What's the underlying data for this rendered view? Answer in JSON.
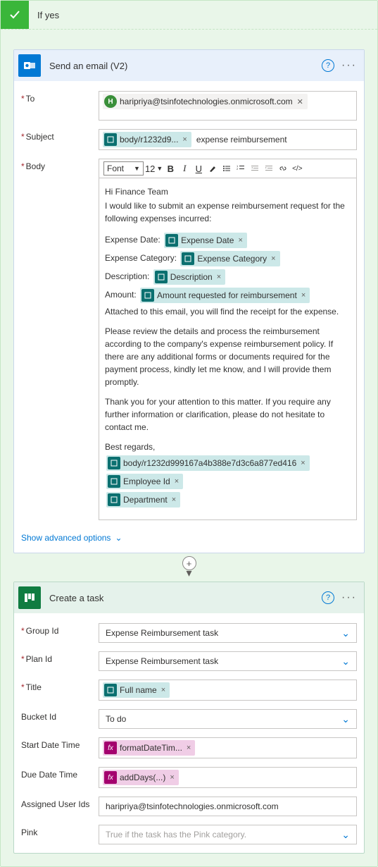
{
  "condition": {
    "title": "If yes"
  },
  "email_action": {
    "title": "Send an email (V2)",
    "fields": {
      "to_label": "To",
      "subject_label": "Subject",
      "body_label": "Body"
    },
    "to_pill": "haripriya@tsinfotechnologies.onmicrosoft.com",
    "subject_token": "body/r1232d9...",
    "subject_text": "expense reimbursement",
    "toolbar": {
      "font": "Font",
      "size": "12"
    },
    "body": {
      "greeting": "Hi Finance Team",
      "intro": "I would like to submit an expense reimbursement request for the following expenses incurred:",
      "line_date_label": "Expense Date:",
      "token_date": "Expense Date",
      "line_cat_label": "Expense Category:",
      "token_cat": "Expense Category",
      "line_desc_label": "Description:",
      "token_desc": "Description",
      "line_amount_label": "Amount:",
      "token_amount": "Amount requested for reimbursement",
      "attach": "Attached to this email, you will find the receipt for the expense.",
      "review": "Please review the details and process the reimbursement according to the company's expense reimbursement policy. If there are any additional forms or documents required for the payment process, kindly let me know, and I will provide them promptly.",
      "thanks": "Thank you for your attention to this matter. If you require any further information or clarification, please do not hesitate to contact me.",
      "regards": "Best regards,",
      "token_body_hash": "body/r1232d999167a4b388e7d3c6a877ed416",
      "token_emp": "Employee Id",
      "token_dept": "Department"
    },
    "advanced": "Show advanced options"
  },
  "task_action": {
    "title": "Create a task",
    "fields": {
      "group_label": "Group Id",
      "group_value": "Expense Reimbursement task",
      "plan_label": "Plan Id",
      "plan_value": "Expense Reimbursement task",
      "title_label": "Title",
      "title_token": "Full name",
      "bucket_label": "Bucket Id",
      "bucket_value": "To do",
      "start_label": "Start Date Time",
      "start_token": "formatDateTim...",
      "due_label": "Due Date Time",
      "due_token": "addDays(...)",
      "assigned_label": "Assigned User Ids",
      "assigned_value": "haripriya@tsinfotechnologies.onmicrosoft.com",
      "pink_label": "Pink",
      "pink_placeholder": "True if the task has the Pink category."
    }
  }
}
